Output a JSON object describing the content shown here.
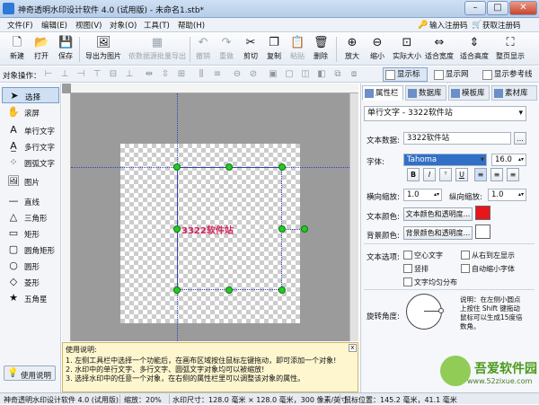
{
  "window": {
    "title": "神奇透明水印设计软件 4.0 (试用版) - 未命名1.stb*",
    "min": "–",
    "max": "□",
    "close": "✕"
  },
  "menu": {
    "items": [
      "文件(F)",
      "编辑(E)",
      "视图(V)",
      "对象(O)",
      "工具(T)",
      "帮助(H)"
    ],
    "register": "输入注册码",
    "buy": "获取注册码"
  },
  "toolbar": {
    "new": "新建",
    "open": "打开",
    "save": "保存",
    "export": "导出为图片",
    "batch": "依数据源批量导出",
    "undo": "撤销",
    "redo": "重做",
    "cut": "剪切",
    "copy": "复制",
    "paste": "粘贴",
    "delete": "删除",
    "zoom_in": "放大",
    "zoom_out": "缩小",
    "actual": "实际大小",
    "fit_width": "适合宽度",
    "fit_height": "适合高度",
    "fullscreen": "整页显示"
  },
  "alignbar": {
    "label": "对象操作：",
    "show_ruler": "显示标尺",
    "show_grid": "显示网格",
    "show_ref": "显示参考线"
  },
  "tools": [
    "选择",
    "滚屏",
    "单行文字",
    "多行文字",
    "圆弧文字",
    "图片",
    "直线",
    "三角形",
    "矩形",
    "圆角矩形",
    "圆形",
    "菱形",
    "五角星"
  ],
  "help_btn": "使用说明",
  "canvas": {
    "text": "3322软件站"
  },
  "help": {
    "title": "使用说明:",
    "line1": "1. 左侧工具栏中选择一个功能后，在画布区域按住鼠标左键拖动，即可添加一个对象!",
    "line2": "2. 水印中的单行文字、多行文字、圆弧文字对象均可以被缩放!",
    "line3": "3. 选择水印中的任意一个对象，在右侧的属性栏里可以调整该对象的属性。",
    "close": "x"
  },
  "panel": {
    "tabs": [
      "属性栏",
      "数据库",
      "模板库",
      "素材库"
    ],
    "object": "单行文字 - 3322软件站",
    "data_label": "文本数据:",
    "data_value": "3322软件站",
    "font_label": "字体:",
    "font_value": "Tahoma",
    "font_size": "16.0",
    "bold": "B",
    "italic": "I",
    "strike": "ᵀ",
    "underline": "U",
    "hscale_label": "横向缩放:",
    "hscale": "1.0",
    "vscale_label": "纵向缩放:",
    "vscale": "1.0",
    "text_color_label": "文本颜色:",
    "color_btn": "文本颜色和透明度...",
    "bg_color_label": "背景颜色:",
    "bg_btn": "背景颜色和透明度...",
    "options_label": "文本选项:",
    "opt_hollow": "空心文字",
    "opt_rtl": "从右到左显示",
    "opt_vertical": "竖排",
    "opt_autoshrink": "自动缩小字体",
    "opt_distribute": "文字均匀分布",
    "rotate_label": "旋转角度:",
    "rotate_desc1": "说明：在左侧小圆点",
    "rotate_desc2": "上按住 Shift 键拖动",
    "rotate_desc3": "鼠标可以生成15度倍",
    "rotate_desc4": "数角。",
    "text_color": "#e8151b",
    "bg_color": "#ffffff"
  },
  "status": {
    "app": "神奇透明水印设计软件 4.0 (试用版)",
    "zoom": "缩放：20%",
    "size": "水印尺寸：128.0 毫米 × 128.0 毫米，300 像素/英寸",
    "pos": "鼠标位置：145.2 毫米，41.1 毫米"
  },
  "watermark": {
    "line1": "吾爱软件园",
    "line2": "www.52zixue.com"
  }
}
